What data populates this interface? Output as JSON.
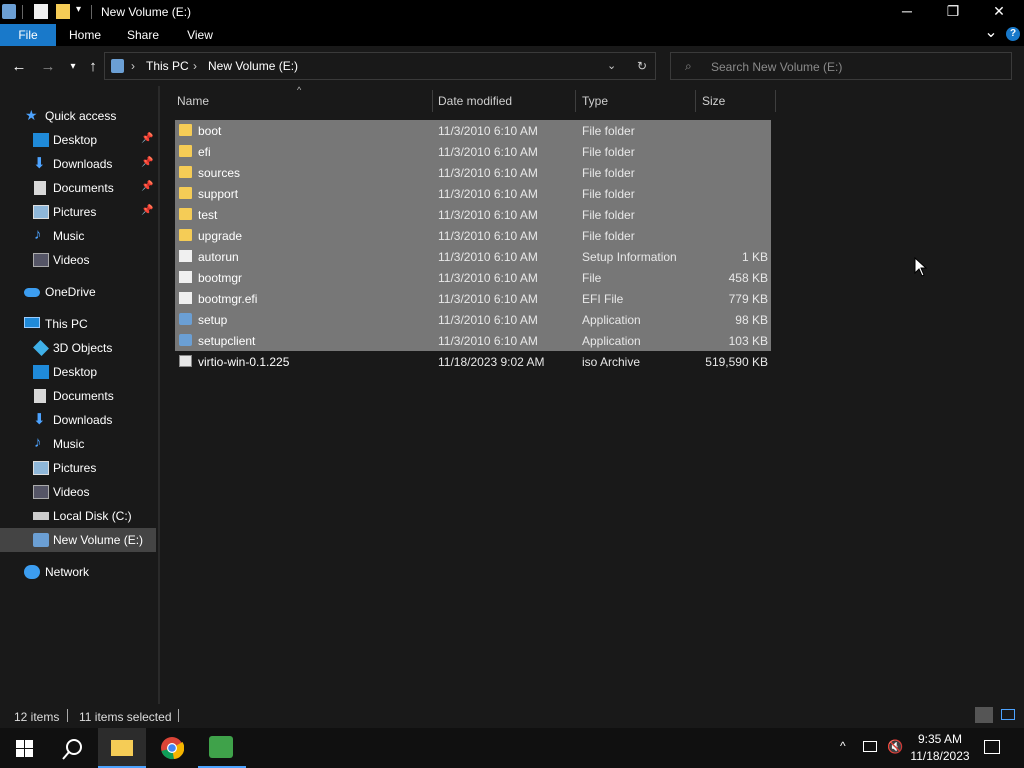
{
  "window": {
    "title": "New Volume (E:)",
    "minimize": "─",
    "restore": "❐",
    "close": "✕"
  },
  "ribbon": {
    "tabs": [
      "File",
      "Home",
      "Share",
      "View"
    ],
    "expand": "⌄",
    "help": "?"
  },
  "address": {
    "crumbs": [
      "This PC",
      "New Volume (E:)"
    ],
    "search_placeholder": "Search New Volume (E:)"
  },
  "nav": {
    "quick_access": "Quick access",
    "quick_items": [
      "Desktop",
      "Downloads",
      "Documents",
      "Pictures",
      "Music",
      "Videos"
    ],
    "onedrive": "OneDrive",
    "this_pc": "This PC",
    "pc_items": [
      "3D Objects",
      "Desktop",
      "Documents",
      "Downloads",
      "Music",
      "Pictures",
      "Videos",
      "Local Disk (C:)",
      "New Volume (E:)"
    ],
    "network": "Network"
  },
  "columns": {
    "name": "Name",
    "date": "Date modified",
    "type": "Type",
    "size": "Size"
  },
  "files": [
    {
      "name": "boot",
      "date": "11/3/2010 6:10 AM",
      "type": "File folder",
      "size": "",
      "icon": "folder-icon",
      "selected": true
    },
    {
      "name": "efi",
      "date": "11/3/2010 6:10 AM",
      "type": "File folder",
      "size": "",
      "icon": "folder-icon",
      "selected": true
    },
    {
      "name": "sources",
      "date": "11/3/2010 6:10 AM",
      "type": "File folder",
      "size": "",
      "icon": "folder-icon",
      "selected": true
    },
    {
      "name": "support",
      "date": "11/3/2010 6:10 AM",
      "type": "File folder",
      "size": "",
      "icon": "folder-icon",
      "selected": true
    },
    {
      "name": "test",
      "date": "11/3/2010 6:10 AM",
      "type": "File folder",
      "size": "",
      "icon": "folder-icon",
      "selected": true
    },
    {
      "name": "upgrade",
      "date": "11/3/2010 6:10 AM",
      "type": "File folder",
      "size": "",
      "icon": "folder-icon",
      "selected": true
    },
    {
      "name": "autorun",
      "date": "11/3/2010 6:10 AM",
      "type": "Setup Information",
      "size": "1 KB",
      "icon": "settings-file-icon",
      "selected": true
    },
    {
      "name": "bootmgr",
      "date": "11/3/2010 6:10 AM",
      "type": "File",
      "size": "458 KB",
      "icon": "file-icon",
      "selected": true
    },
    {
      "name": "bootmgr.efi",
      "date": "11/3/2010 6:10 AM",
      "type": "EFI File",
      "size": "779 KB",
      "icon": "file-icon",
      "selected": true
    },
    {
      "name": "setup",
      "date": "11/3/2010 6:10 AM",
      "type": "Application",
      "size": "98 KB",
      "icon": "application-icon",
      "selected": true
    },
    {
      "name": "setupclient",
      "date": "11/3/2010 6:10 AM",
      "type": "Application",
      "size": "103 KB",
      "icon": "application-icon",
      "selected": true
    },
    {
      "name": "virtio-win-0.1.225",
      "date": "11/18/2023 9:02 AM",
      "type": "iso Archive",
      "size": "519,590 KB",
      "icon": "iso-file-icon",
      "selected": false
    }
  ],
  "status": {
    "count": "12 items",
    "selected": "11 items selected"
  },
  "clock": {
    "time": "9:35 AM",
    "date": "11/18/2023"
  },
  "colors": {
    "accent": "#1979ca",
    "selection": "#777777",
    "folder": "#f5cc56"
  }
}
